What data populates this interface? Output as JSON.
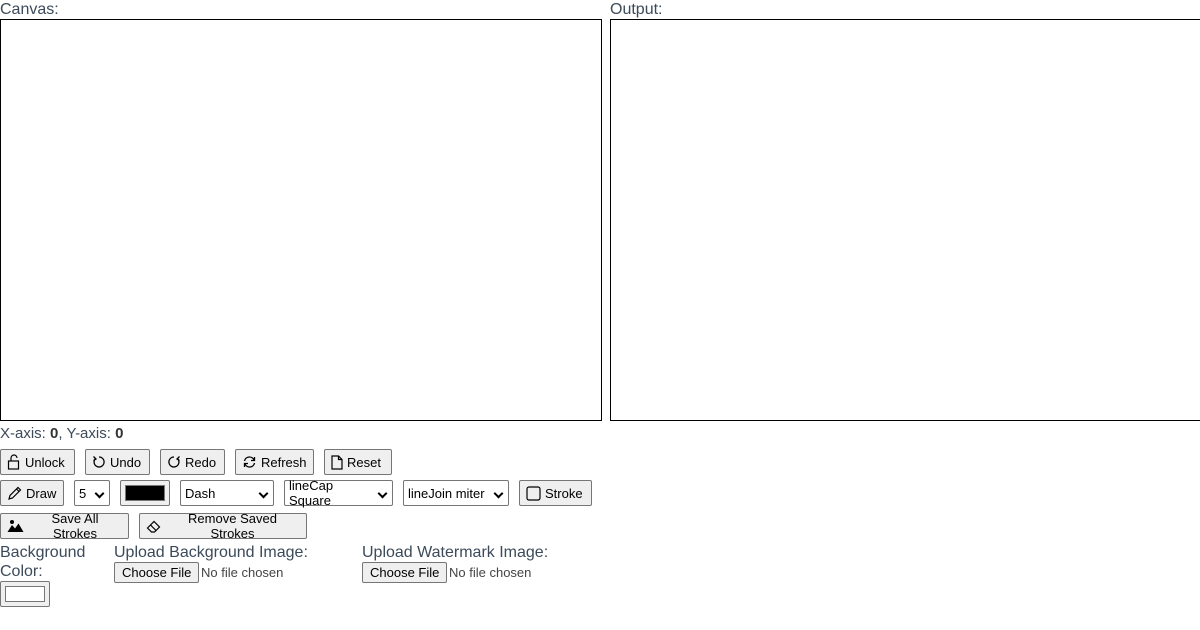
{
  "panels": {
    "canvas_label": "Canvas:",
    "output_label": "Output:"
  },
  "coords": {
    "x_label": "X-axis:",
    "x_value": "0",
    "y_label": "Y-axis:",
    "y_value": "0"
  },
  "toolbar_row1": {
    "unlock": "Unlock",
    "undo": "Undo",
    "redo": "Redo",
    "refresh": "Refresh",
    "reset": "Reset"
  },
  "toolbar_row2": {
    "draw": "Draw",
    "line_width": "5",
    "stroke_color": "#000000",
    "line_style": "Dash",
    "line_cap": "lineCap Square",
    "line_join": "lineJoin miter",
    "stroke": "Stroke"
  },
  "toolbar_row3": {
    "save_all": "Save All Strokes",
    "remove_saved": "Remove Saved Strokes"
  },
  "background": {
    "color_label_1": "Background",
    "color_label_2": "Color:",
    "color_value": "#ffffff",
    "upload_bg_label": "Upload Background Image:",
    "upload_wm_label": "Upload Watermark Image:",
    "choose_file": "Choose File",
    "no_file": "No file chosen"
  }
}
